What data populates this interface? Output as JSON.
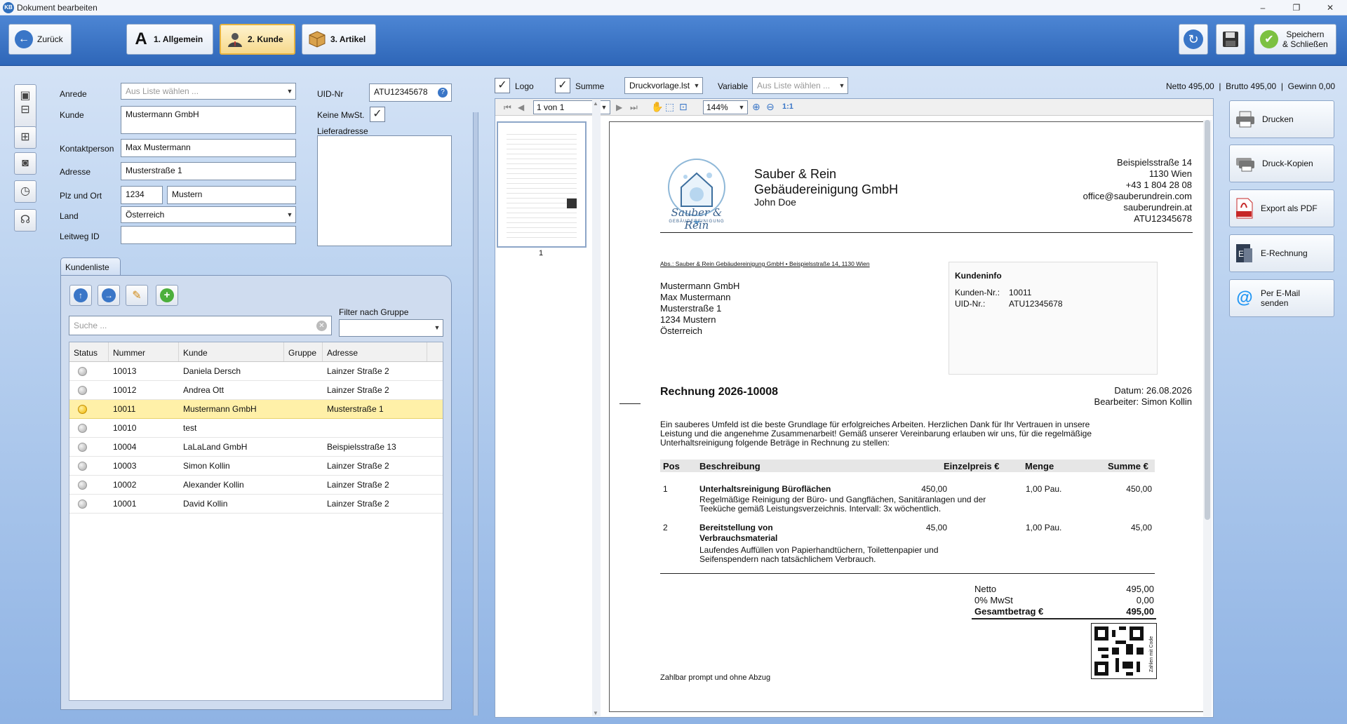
{
  "window": {
    "app_icon": "KB",
    "title": "Dokument bearbeiten",
    "controls": [
      "–",
      "❐",
      "✕"
    ]
  },
  "toolbar": {
    "back_label": "Zurück",
    "tabs": [
      {
        "label": "1. Allgemein",
        "icon": "letter-a-icon"
      },
      {
        "label": "2. Kunde",
        "icon": "person-icon"
      },
      {
        "label": "3. Artikel",
        "icon": "box-icon"
      }
    ],
    "save_close_label_1": "Speichern",
    "save_close_label_2": "& Schließen"
  },
  "form": {
    "anrede_label": "Anrede",
    "anrede_placeholder": "Aus Liste wählen ...",
    "kunde_label": "Kunde",
    "kunde_value": "Mustermann GmbH",
    "kontakt_label": "Kontaktperson",
    "kontakt_value": "Max Mustermann",
    "adresse_label": "Adresse",
    "adresse_value": "Musterstraße 1",
    "plz_label": "Plz und Ort",
    "plz_value": "1234",
    "ort_value": "Mustern",
    "land_label": "Land",
    "land_value": "Österreich",
    "leitweg_label": "Leitweg ID",
    "leitweg_value": "",
    "uid_label": "UID-Nr",
    "uid_value": "ATU12345678",
    "keine_mwst_label": "Keine MwSt.",
    "keine_mwst_checked": true,
    "lieferadresse_label": "Lieferadresse",
    "lieferadresse_value": ""
  },
  "kundenliste": {
    "tab_label": "Kundenliste",
    "filter_label": "Filter nach Gruppe",
    "search_placeholder": "Suche ...",
    "columns": [
      "Status",
      "Nummer",
      "Kunde",
      "Gruppe",
      "Adresse"
    ],
    "rows": [
      {
        "active": false,
        "nummer": "10013",
        "kunde": "Daniela Dersch",
        "gruppe": "",
        "adresse": "Lainzer Straße 2"
      },
      {
        "active": false,
        "nummer": "10012",
        "kunde": "Andrea Ott",
        "gruppe": "",
        "adresse": "Lainzer Straße  2"
      },
      {
        "active": true,
        "nummer": "10011",
        "kunde": "Mustermann GmbH",
        "gruppe": "",
        "adresse": "Musterstraße 1"
      },
      {
        "active": false,
        "nummer": "10010",
        "kunde": "test",
        "gruppe": "",
        "adresse": ""
      },
      {
        "active": false,
        "nummer": "10004",
        "kunde": "LaLaLand GmbH",
        "gruppe": "",
        "adresse": "Beispielsstraße 13"
      },
      {
        "active": false,
        "nummer": "10003",
        "kunde": "Simon Kollin",
        "gruppe": "",
        "adresse": "Lainzer Straße 2"
      },
      {
        "active": false,
        "nummer": "10002",
        "kunde": "Alexander Kollin",
        "gruppe": "",
        "adresse": "Lainzer Straße 2"
      },
      {
        "active": false,
        "nummer": "10001",
        "kunde": "David Kollin",
        "gruppe": "",
        "adresse": "Lainzer Straße 2"
      }
    ]
  },
  "report": {
    "logo_label": "Logo",
    "logo_checked": true,
    "summe_label": "Summe",
    "summe_checked": true,
    "template_value": "Druckvorlage.lst",
    "variable_label": "Variable",
    "variable_placeholder": "Aus Liste wählen ...",
    "totals_text": "Netto 495,00  |  Brutto 495,00  |  Gewinn 0,00",
    "page_value": "1 von 1",
    "zoom_value": "144%",
    "zoom_reset": "1:1",
    "thumb_page": "1"
  },
  "invoice": {
    "logo_text": "Sauber & Rein",
    "logo_sub": "GEBÄUDEREINIGUNG",
    "company_line1": "Sauber & Rein",
    "company_line2": "Gebäudereinigung GmbH",
    "company_contact": "John Doe",
    "sender_lines": [
      "Beispielsstraße 14",
      "1130 Wien",
      "+43 1 804 28 08",
      "office@sauberundrein.com",
      "sauberundrein.at",
      "ATU12345678"
    ],
    "return_address": "Abs.: Sauber & Rein Gebäudereinigung GmbH • Beispielsstraße 14, 1130 Wien",
    "recipient_lines": [
      "Mustermann GmbH",
      "Max Mustermann",
      "Musterstraße 1",
      "1234 Mustern",
      "Österreich"
    ],
    "kundeninfo_title": "Kundeninfo",
    "kundennr_label": "Kunden-Nr.:",
    "kundennr_value": "10011",
    "uidnr_label": "UID-Nr.:",
    "uidnr_value": "ATU12345678",
    "heading": "Rechnung 2026-10008",
    "datum": "Datum: 26.08.2026",
    "bearbeiter": "Bearbeiter: Simon Kollin",
    "intro_lines": [
      "Ein sauberes Umfeld ist die beste Grundlage für erfolgreiches Arbeiten. Herzlichen Dank für Ihr Vertrauen in unsere",
      "Leistung und die angenehme Zusammenarbeit! Gemäß unserer Vereinbarung erlauben wir uns, für die regelmäßige",
      "Unterhaltsreinigung folgende Beträge in Rechnung zu stellen:"
    ],
    "table_headers": [
      "Pos",
      "Beschreibung",
      "Einzelpreis €",
      "Menge",
      "Summe €"
    ],
    "items": [
      {
        "pos": "1",
        "title": "Unterhaltsreinigung Büroflächen",
        "title2": "",
        "desc1": "Regelmäßige Reinigung der Büro- und Gangflächen, Sanitäranlagen und der",
        "desc2": "Teeküche gemäß Leistungsverzeichnis. Intervall: 3x wöchentlich.",
        "price": "450,00",
        "qty": "1,00 Pau.",
        "sum": "450,00"
      },
      {
        "pos": "2",
        "title": "Bereitstellung von",
        "title2": "Verbrauchsmaterial",
        "desc1": "Laufendes Auffüllen von Papierhandtüchern, Toilettenpapier und",
        "desc2": "Seifenspendern nach tatsächlichem Verbrauch.",
        "price": "45,00",
        "qty": "1,00 Pau.",
        "sum": "45,00"
      }
    ],
    "netto_label": "Netto",
    "netto_value": "495,00",
    "mwst_label": "0% MwSt",
    "mwst_value": "0,00",
    "gesamt_label": "Gesamtbetrag €",
    "gesamt_value": "495,00",
    "qr_caption": "Zahlen mit Code",
    "footer_text": "Zahlbar prompt und ohne Abzug"
  },
  "actions": [
    "Drucken",
    "Druck-Kopien",
    "Export als PDF",
    "E-Rechnung",
    "Per E-Mail senden"
  ],
  "colors": {
    "toolbar": "#2e66b8",
    "selected_row": "#fff0a8",
    "accent": "#3a76c7"
  }
}
